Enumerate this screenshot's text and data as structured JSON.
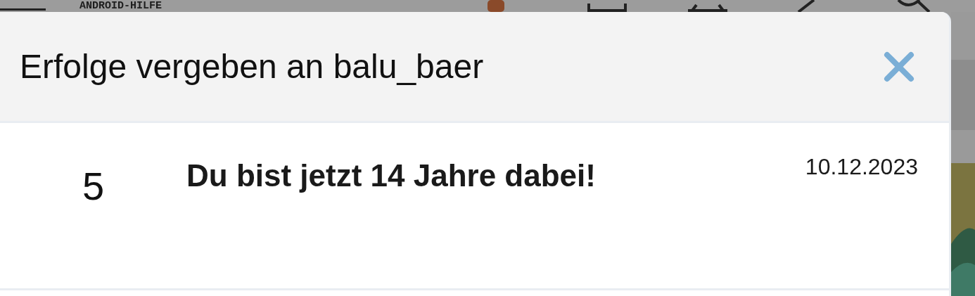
{
  "backdrop": {
    "logo": "ANDROID-HILFE"
  },
  "dialog": {
    "title": "Erfolge vergeben an balu_baer"
  },
  "achievements": [
    {
      "points": "5",
      "title": "Du bist jetzt 14 Jahre dabei!",
      "date": "10.12.2023"
    }
  ]
}
